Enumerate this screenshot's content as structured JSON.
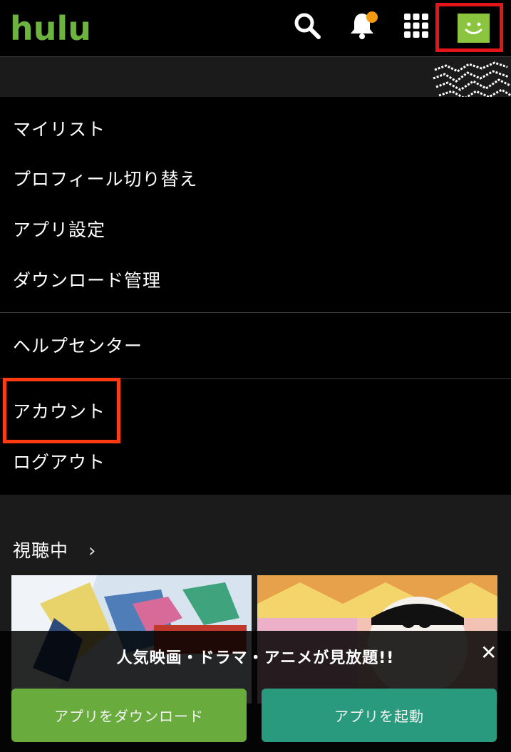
{
  "header": {
    "logo_text": "hulu",
    "icons": [
      "search-icon",
      "bell-icon",
      "grid-icon",
      "profile-avatar-icon"
    ],
    "brand_color": "#6cb33f",
    "notification_dot_color": "#f39c12"
  },
  "menu": {
    "items": [
      {
        "label": "マイリスト"
      },
      {
        "label": "プロフィール切り替え"
      },
      {
        "label": "アプリ設定"
      },
      {
        "label": "ダウンロード管理"
      },
      {
        "label": "ヘルプセンター"
      },
      {
        "label": "アカウント"
      },
      {
        "label": "ログアウト"
      }
    ]
  },
  "continue_watching": {
    "title": "視聴中",
    "chevron": "›"
  },
  "banner": {
    "message": "人気映画・ドラマ・アニメが見放題!!",
    "close_label": "✕",
    "download_button": "アプリをダウンロード",
    "launch_button": "アプリを起動"
  },
  "annotation_color": "#e3141a"
}
